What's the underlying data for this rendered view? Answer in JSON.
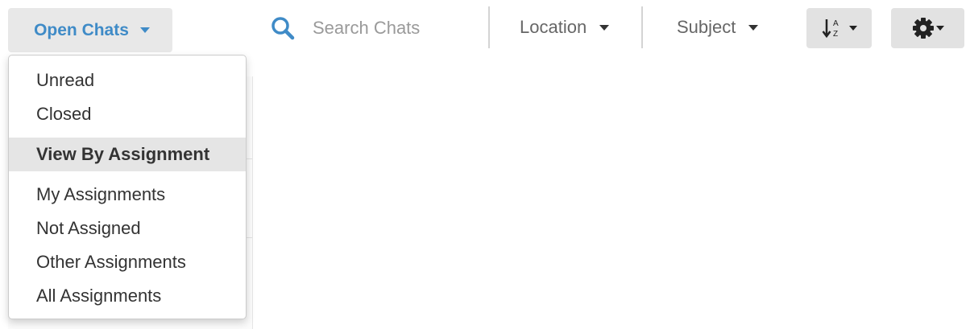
{
  "toolbar": {
    "open_chats_label": "Open Chats",
    "search_placeholder": "Search Chats",
    "location_label": "Location",
    "subject_label": "Subject",
    "sort_icon": "sort-alpha-icon",
    "settings_icon": "gear-icon"
  },
  "dropdown": {
    "items_top": [
      "Unread",
      "Closed"
    ],
    "header": "View By Assignment",
    "items_assignment": [
      "My Assignments",
      "Not Assigned",
      "Other Assignments",
      "All Assignments"
    ]
  },
  "colors": {
    "accent": "#3f8bc7",
    "button_bg": "#e8e8e8",
    "header_bg": "#e5e5e5"
  }
}
